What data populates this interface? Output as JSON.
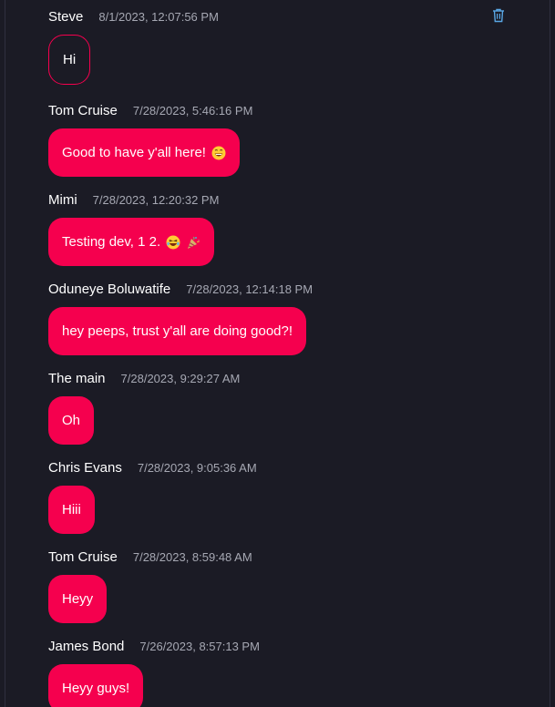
{
  "colors": {
    "background": "#1b1b25",
    "bubble": "#f5004e",
    "timestamp": "#a6a8b3",
    "icon": "#5aa8e6"
  },
  "messages": [
    {
      "author": "Steve",
      "time": "8/1/2023, 12:07:56 PM",
      "text": "Hi",
      "style": "outline",
      "deletable": true,
      "emoji": []
    },
    {
      "author": "Tom Cruise",
      "time": "7/28/2023, 5:46:16 PM",
      "text": "Good to have y'all here!",
      "style": "filled",
      "emoji": [
        "grinning-face"
      ]
    },
    {
      "author": "Mimi",
      "time": "7/28/2023, 12:20:32 PM",
      "text": "Testing dev, 1 2.",
      "style": "filled",
      "emoji": [
        "laughing-face",
        "party-popper"
      ]
    },
    {
      "author": "Oduneye Boluwatife",
      "time": "7/28/2023, 12:14:18 PM",
      "text": "hey peeps, trust y'all are doing good?!",
      "style": "filled",
      "emoji": []
    },
    {
      "author": "The main",
      "time": "7/28/2023, 9:29:27 AM",
      "text": "Oh",
      "style": "filled",
      "emoji": []
    },
    {
      "author": "Chris Evans",
      "time": "7/28/2023, 9:05:36 AM",
      "text": "Hiii",
      "style": "filled",
      "emoji": []
    },
    {
      "author": "Tom Cruise",
      "time": "7/28/2023, 8:59:48 AM",
      "text": "Heyy",
      "style": "filled",
      "emoji": []
    },
    {
      "author": "James Bond",
      "time": "7/26/2023, 8:57:13 PM",
      "text": "Heyy guys!",
      "style": "filled",
      "emoji": []
    }
  ],
  "icons": {
    "delete": "trash-icon"
  }
}
